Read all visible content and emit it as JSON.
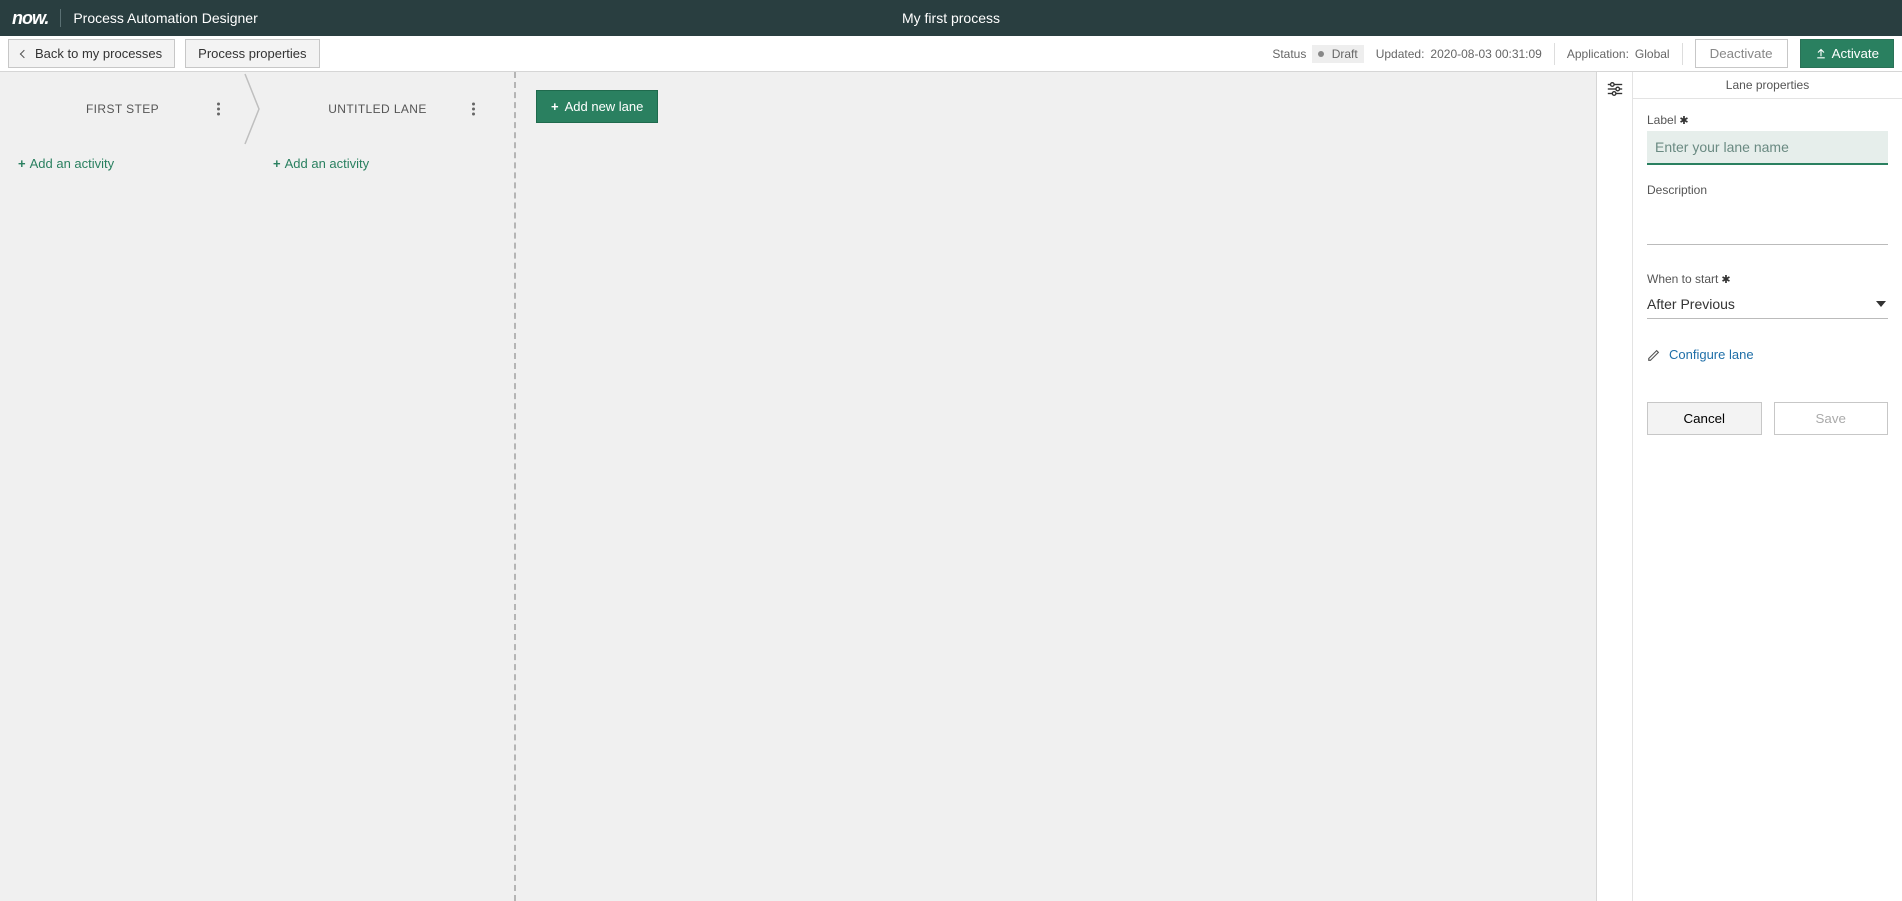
{
  "header": {
    "logo_text": "now.",
    "app_name": "Process Automation Designer",
    "process_title": "My first process"
  },
  "subbar": {
    "back_label": "Back to my processes",
    "properties_label": "Process properties",
    "status_label": "Status",
    "status_value": "Draft",
    "updated_label": "Updated:",
    "updated_value": "2020-08-03 00:31:09",
    "application_label": "Application:",
    "application_value": "Global",
    "deactivate_label": "Deactivate",
    "activate_label": "Activate"
  },
  "canvas": {
    "lanes": [
      {
        "title": "FIRST STEP",
        "add_activity": "Add an activity"
      },
      {
        "title": "UNTITLED LANE",
        "add_activity": "Add an activity"
      }
    ],
    "add_lane_label": "Add new lane"
  },
  "panel": {
    "title": "Lane properties",
    "label_field": "Label",
    "label_placeholder": "Enter your lane name",
    "label_value": "",
    "description_field": "Description",
    "description_value": "",
    "when_field": "When to start",
    "when_value": "After Previous",
    "configure_link": "Configure lane",
    "cancel_label": "Cancel",
    "save_label": "Save"
  }
}
